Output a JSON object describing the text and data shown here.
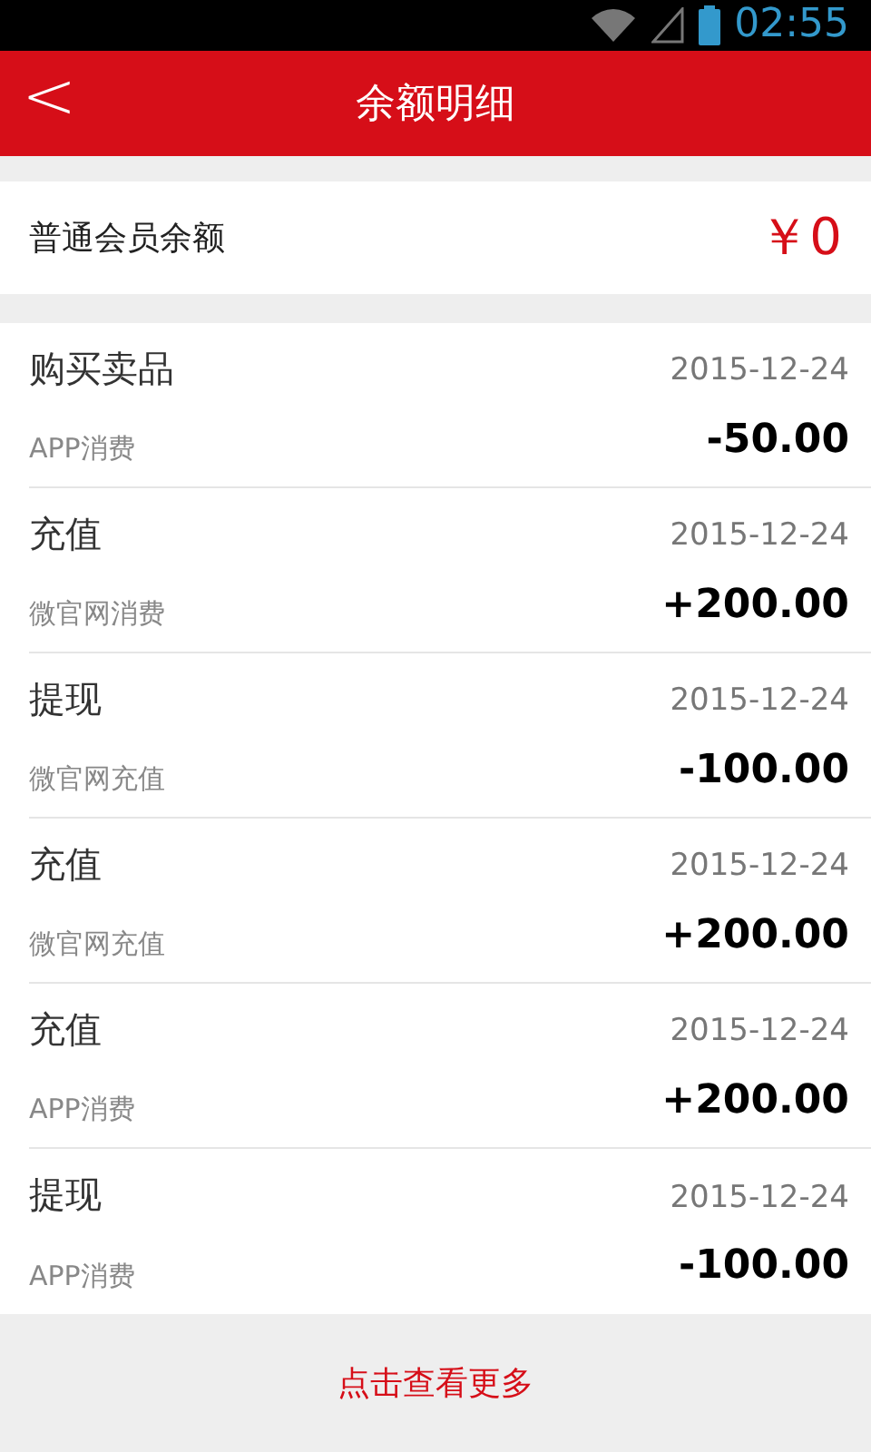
{
  "status_bar": {
    "time": "02:55"
  },
  "header": {
    "back": "<",
    "title": "余额明细"
  },
  "balance": {
    "label": "普通会员余额",
    "amount": "￥0"
  },
  "records": [
    {
      "title": "购买卖品",
      "date": "2015-12-24",
      "source": "APP消费",
      "amount": "-50.00"
    },
    {
      "title": "充值",
      "date": "2015-12-24",
      "source": "微官网消费",
      "amount": "+200.00"
    },
    {
      "title": "提现",
      "date": "2015-12-24",
      "source": "微官网充值",
      "amount": "-100.00"
    },
    {
      "title": "充值",
      "date": "2015-12-24",
      "source": "微官网充值",
      "amount": "+200.00"
    },
    {
      "title": "充值",
      "date": "2015-12-24",
      "source": "APP消费",
      "amount": "+200.00"
    },
    {
      "title": "提现",
      "date": "2015-12-24",
      "source": "APP消费",
      "amount": "-100.00"
    }
  ],
  "more_button": "点击查看更多"
}
